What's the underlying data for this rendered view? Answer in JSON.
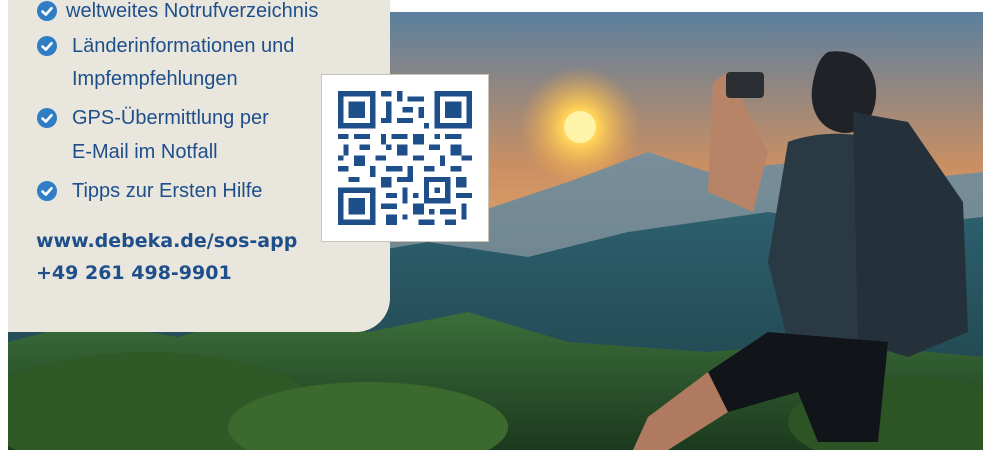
{
  "features": [
    {
      "label": "weltweites Notrufverzeichnis",
      "icon": "check-circle-icon"
    },
    {
      "label": "Länderinformationen und",
      "icon": "check-circle-icon"
    },
    {
      "label": "Impfempfehlungen"
    },
    {
      "label": "GPS-Übermittlung per",
      "icon": "check-circle-icon"
    },
    {
      "label": "E-Mail im Notfall"
    },
    {
      "label": "Tipps zur Ersten Hilfe",
      "icon": "check-circle-icon"
    }
  ],
  "contact": {
    "url": "www.debeka.de/sos-app",
    "phone": "+49 261 498-9901"
  },
  "colors": {
    "panel": "#e9e6de",
    "text": "#1f4f8a",
    "accent": "#2e7dc5"
  }
}
